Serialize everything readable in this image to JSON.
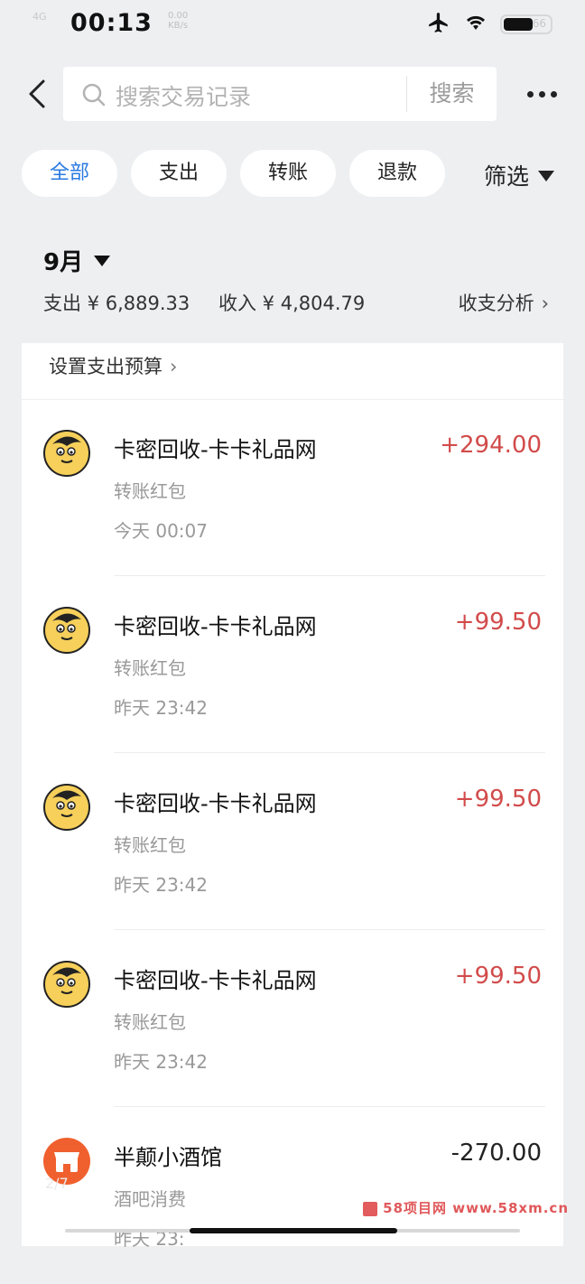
{
  "status_bar": {
    "time": "00:13",
    "faded_text": "4G",
    "network_speed": "0.00",
    "network_unit": "KB/s",
    "battery": "66"
  },
  "header": {
    "search_placeholder": "搜索交易记录",
    "search_button": "搜索"
  },
  "filters": {
    "chips": [
      "全部",
      "支出",
      "转账",
      "退款"
    ],
    "active": "全部",
    "filter_label": "筛选"
  },
  "summary": {
    "month": "9月",
    "expense": "支出 ¥ 6,889.33",
    "income": "收入 ¥ 4,804.79",
    "analysis": "收支分析",
    "budget": "设置支出预算"
  },
  "transactions": [
    {
      "name": "卡密回收-卡卡礼品网",
      "kind": "转账红包",
      "time": "今天 00:07",
      "amount": "+294.00",
      "direction": "in"
    },
    {
      "name": "卡密回收-卡卡礼品网",
      "kind": "转账红包",
      "time": "昨天 23:42",
      "amount": "+99.50",
      "direction": "in"
    },
    {
      "name": "卡密回收-卡卡礼品网",
      "kind": "转账红包",
      "time": "昨天 23:42",
      "amount": "+99.50",
      "direction": "in"
    },
    {
      "name": "卡密回收-卡卡礼品网",
      "kind": "转账红包",
      "time": "昨天 23:42",
      "amount": "+99.50",
      "direction": "in"
    },
    {
      "name": "半颠小酒馆",
      "kind": "酒吧消费",
      "time": "昨天 23:",
      "amount": "-270.00",
      "direction": "out"
    }
  ],
  "watermark": "58项目网 www.58xm.cn",
  "page_marker": "2/7",
  "colors": {
    "accent": "#2a7ae2",
    "income": "#d24b4b",
    "background": "#eeeff1"
  }
}
